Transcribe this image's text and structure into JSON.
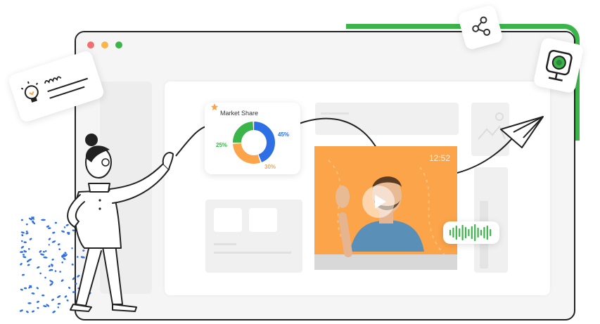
{
  "market_share": {
    "title": "Market Share",
    "slices": [
      {
        "label": "45%",
        "value": 45,
        "color": "#2f6fe6"
      },
      {
        "label": "30%",
        "value": 30,
        "color": "#fba44a"
      },
      {
        "label": "25%",
        "value": 25,
        "color": "#3bb54a"
      }
    ]
  },
  "video": {
    "time": "12:52"
  },
  "colors": {
    "accent_green": "#3bb54a",
    "accent_orange": "#fba44a",
    "accent_blue": "#2f6fe6",
    "window_red": "#f36f6f",
    "window_yellow": "#f7b54a",
    "window_green": "#3bb54a"
  },
  "icons": [
    "share-icon",
    "webcam-icon",
    "lightbulb-icon",
    "star-icon",
    "play-icon",
    "paper-plane-icon",
    "sound-wave-icon",
    "image-icon"
  ]
}
